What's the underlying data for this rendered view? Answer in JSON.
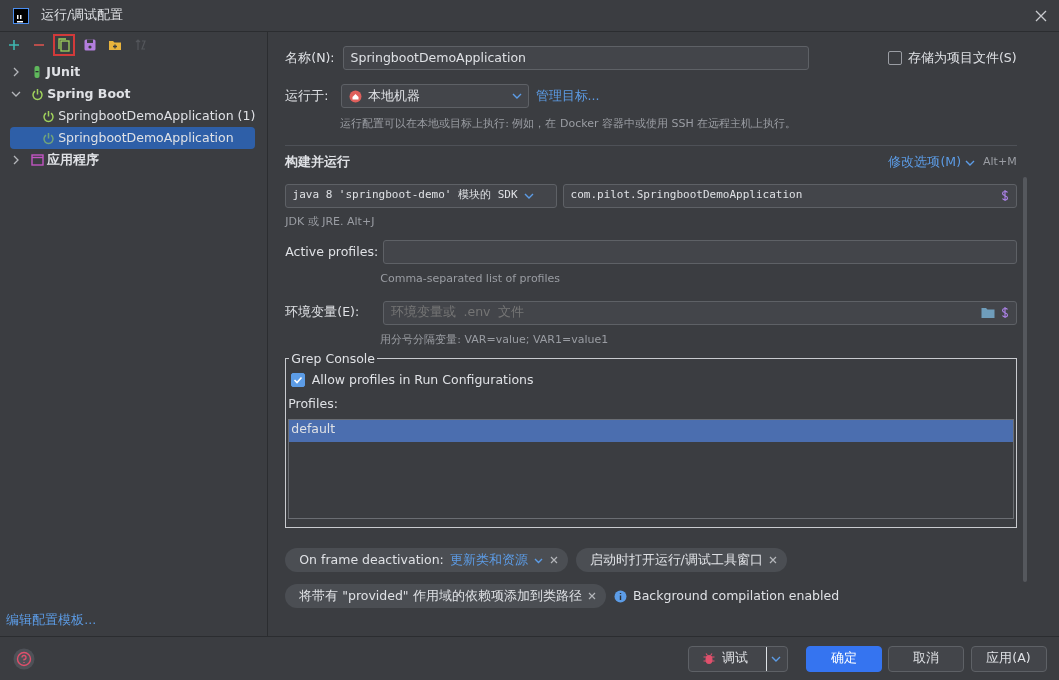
{
  "window": {
    "title": "运行/调试配置"
  },
  "toolbar": [
    {
      "kind": "add",
      "disabled": false,
      "highlighted": false
    },
    {
      "kind": "remove",
      "disabled": false,
      "highlighted": false
    },
    {
      "kind": "copy",
      "disabled": false,
      "highlighted": true
    },
    {
      "kind": "save",
      "disabled": false,
      "highlighted": false
    },
    {
      "kind": "folder",
      "disabled": false,
      "highlighted": false
    },
    {
      "kind": "sort",
      "disabled": true,
      "highlighted": false
    }
  ],
  "tree": [
    {
      "label": "JUnit",
      "kind": "junit",
      "expanded": false,
      "selected": false
    },
    {
      "label": "Spring Boot",
      "kind": "spring",
      "expanded": true,
      "selected": false,
      "children": [
        {
          "label": "SpringbootDemoApplication (1)",
          "kind": "spring",
          "selected": false
        },
        {
          "label": "SpringbootDemoApplication",
          "kind": "spring",
          "selected": true
        }
      ]
    },
    {
      "label": "应用程序",
      "kind": "app",
      "expanded": false,
      "selected": false
    }
  ],
  "edit_templates_link": "编辑配置模板...",
  "form": {
    "name_label": "名称(N):",
    "name_value": "SpringbootDemoApplication",
    "store_checkbox": {
      "label": "存储为项目文件(S)",
      "checked": false
    },
    "run_on": {
      "label": "运行于:",
      "value": "本地机器",
      "link": "管理目标..."
    },
    "run_on_hint": "运行配置可以在本地或目标上执行: 例如，在 Docker 容器中或使用 SSH 在远程主机上执行。",
    "section_title": "构建并运行",
    "modify_options": {
      "label": "修改选项(M)",
      "shortcut": "Alt+M"
    },
    "sdk_value": "java 8 'springboot-demo' 模块的 SDK",
    "main_class_value": "com.pilot.SpringbootDemoApplication",
    "sdk_hint": "JDK 或 JRE. Alt+J",
    "active_profiles": {
      "label": "Active profiles:",
      "hint": "Comma-separated list of profiles"
    },
    "env": {
      "label": "环境变量(E):",
      "placeholder": "环境变量或  .env  文件",
      "hint": "用分号分隔变量: VAR=value; VAR1=value1"
    },
    "grep_console": {
      "title": "Grep Console",
      "allow": {
        "label": "Allow profiles in Run Configurations",
        "checked": true
      },
      "profiles_label": "Profiles:",
      "profiles": [
        {
          "label": "default",
          "selected": true
        }
      ]
    },
    "chips": [
      {
        "label": "On frame deactivation:",
        "value": "更新类和资源"
      },
      {
        "label": "启动时打开运行/调试工具窗口"
      },
      {
        "label": "将带有 \"provided\" 作用域的依赖项添加到类路径"
      }
    ],
    "info": "Background compilation enabled"
  },
  "buttons": [
    {
      "label": "调试",
      "kind": "split"
    },
    {
      "label": "确定",
      "kind": "primary"
    },
    {
      "label": "取消",
      "kind": "normal"
    },
    {
      "label": "应用(A)",
      "kind": "normal"
    }
  ]
}
